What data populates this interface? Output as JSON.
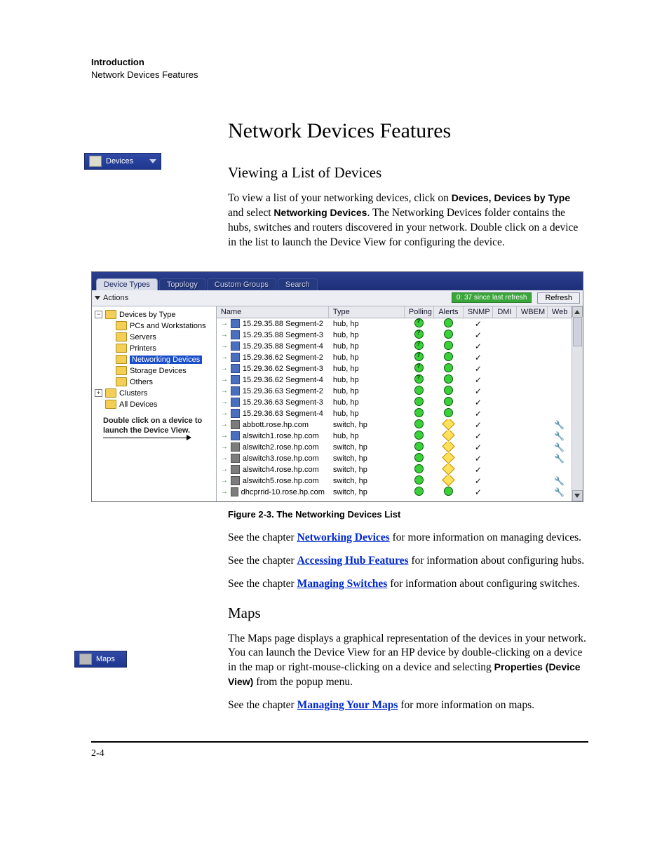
{
  "header": {
    "section": "Introduction",
    "subsection": "Network Devices Features"
  },
  "title": "Network Devices Features",
  "section1": {
    "heading": "Viewing a List of Devices",
    "para_lead": "To view a list of your networking devices, click on ",
    "bold1": "Devices, Devices by Type",
    "mid1": " and select ",
    "bold2": "Networking Devices",
    "tail": ". The Networking Devices folder contains the hubs, switches and routers discovered in your network. Double click on a device in the list to launch the Device View for configuring the device."
  },
  "sidebox1": "Devices",
  "sidebox2": "Maps",
  "app": {
    "tabs": [
      "Device Types",
      "Topology",
      "Custom Groups",
      "Search"
    ],
    "actions": "Actions",
    "since": "0: 37 since last refresh",
    "refresh": "Refresh",
    "tree": {
      "root": "Devices by Type",
      "items": [
        "PCs and Workstations",
        "Servers",
        "Printers",
        "Networking Devices",
        "Storage Devices",
        "Others"
      ],
      "clusters": "Clusters",
      "all": "All Devices",
      "hint1": "Double click on a device to",
      "hint2": "launch the Device View."
    },
    "cols": [
      "Name",
      "Type",
      "Polling",
      "Alerts",
      "SNMP",
      "DMI",
      "WBEM",
      "Web"
    ],
    "rows": [
      {
        "n": "15.29.35.88 Segment-2",
        "t": "hub, hp",
        "p": "q",
        "a": "g",
        "s": true,
        "w": false,
        "k": "seg"
      },
      {
        "n": "15.29.35.88 Segment-3",
        "t": "hub, hp",
        "p": "q",
        "a": "g",
        "s": true,
        "w": false,
        "k": "seg"
      },
      {
        "n": "15.29.35.88 Segment-4",
        "t": "hub, hp",
        "p": "q",
        "a": "g",
        "s": true,
        "w": false,
        "k": "seg"
      },
      {
        "n": "15.29.36.62 Segment-2",
        "t": "hub, hp",
        "p": "q",
        "a": "g",
        "s": true,
        "w": false,
        "k": "seg"
      },
      {
        "n": "15.29.36.62 Segment-3",
        "t": "hub, hp",
        "p": "q",
        "a": "g",
        "s": true,
        "w": false,
        "k": "seg"
      },
      {
        "n": "15.29.36.62 Segment-4",
        "t": "hub, hp",
        "p": "q",
        "a": "g",
        "s": true,
        "w": false,
        "k": "seg"
      },
      {
        "n": "15.29.36.63 Segment-2",
        "t": "hub, hp",
        "p": "g",
        "a": "g",
        "s": true,
        "w": false,
        "k": "seg"
      },
      {
        "n": "15.29.36.63 Segment-3",
        "t": "hub, hp",
        "p": "g",
        "a": "g",
        "s": true,
        "w": false,
        "k": "seg"
      },
      {
        "n": "15.29.36.63 Segment-4",
        "t": "hub, hp",
        "p": "g",
        "a": "g",
        "s": true,
        "w": false,
        "k": "seg"
      },
      {
        "n": "abbott.rose.hp.com",
        "t": "switch, hp",
        "p": "g",
        "a": "d",
        "s": true,
        "w": true,
        "k": "sw"
      },
      {
        "n": "alswitch1.rose.hp.com",
        "t": "hub, hp",
        "p": "g",
        "a": "d",
        "s": true,
        "w": true,
        "k": "seg"
      },
      {
        "n": "alswitch2.rose.hp.com",
        "t": "switch, hp",
        "p": "g",
        "a": "d",
        "s": true,
        "w": true,
        "k": "sw"
      },
      {
        "n": "alswitch3.rose.hp.com",
        "t": "switch, hp",
        "p": "g",
        "a": "d",
        "s": true,
        "w": true,
        "k": "sw"
      },
      {
        "n": "alswitch4.rose.hp.com",
        "t": "switch, hp",
        "p": "g",
        "a": "d",
        "s": true,
        "w": false,
        "k": "sw"
      },
      {
        "n": "alswitch5.rose.hp.com",
        "t": "switch, hp",
        "p": "g",
        "a": "d",
        "s": true,
        "w": true,
        "k": "sw"
      },
      {
        "n": "dhcprrid-10.rose.hp.com",
        "t": "switch, hp",
        "p": "g",
        "a": "g",
        "s": true,
        "w": true,
        "k": "sw"
      }
    ]
  },
  "figcap": "Figure 2-3.    The Networking Devices List",
  "para_refs": {
    "p1a": "See the chapter ",
    "l1": "Networking Devices",
    "p1b": " for more information on managing devices.",
    "p2a": "See the chapter ",
    "l2": "Accessing Hub Features",
    "p2b": " for information about configuring hubs.",
    "p3a": "See the chapter ",
    "l3": "Managing Switches",
    "p3b": " for information about configuring switches."
  },
  "section2": {
    "heading": "Maps",
    "p1": "The Maps page displays a graphical representation of the devices in your network. You can launch the Device View for an HP device by double-clicking on a device in the map or right-mouse-clicking on a device and selecting ",
    "bold": "Properties (Device View)",
    "p1b": " from the popup menu.",
    "p2a": "See the chapter ",
    "l": "Managing Your Maps",
    "p2b": " for more information on maps."
  },
  "pagenum": "2-4"
}
